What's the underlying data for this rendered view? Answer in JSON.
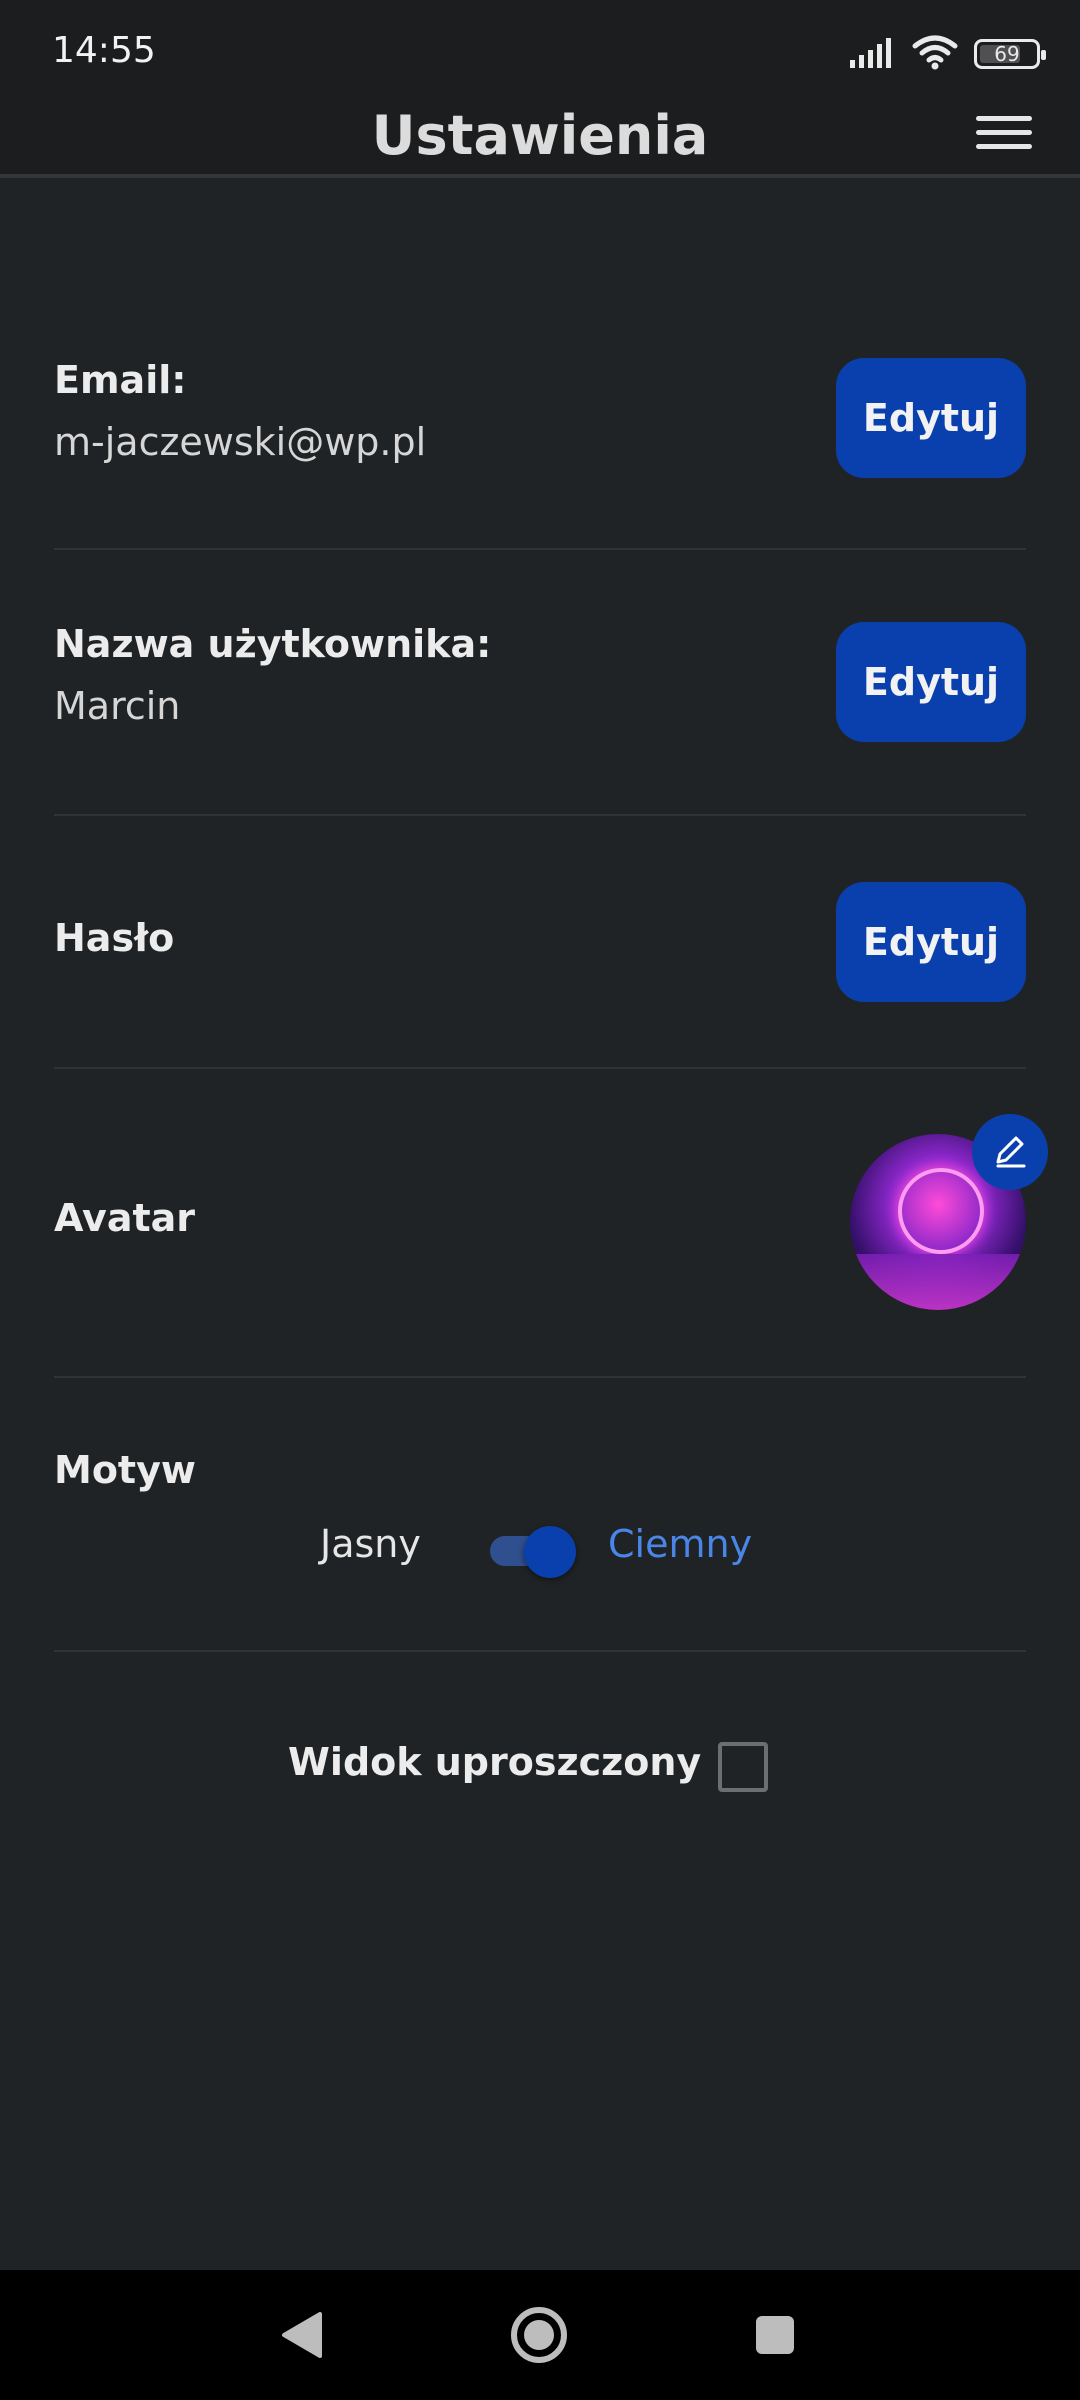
{
  "status_bar": {
    "time": "14:55",
    "battery": "69",
    "icons": [
      "signal-icon",
      "wifi-icon",
      "battery-icon"
    ]
  },
  "app_bar": {
    "title": "Ustawienia",
    "menu_icon": "hamburger-menu-icon"
  },
  "settings": {
    "email": {
      "label": "Email:",
      "value": "m-jaczewski@wp.pl",
      "button": "Edytuj"
    },
    "username": {
      "label": "Nazwa użytkownika:",
      "value": "Marcin",
      "button": "Edytuj"
    },
    "password": {
      "label": "Hasło",
      "button": "Edytuj"
    },
    "avatar": {
      "label": "Avatar",
      "edit_icon": "pencil-icon"
    },
    "theme": {
      "label": "Motyw",
      "light": "Jasny",
      "dark": "Ciemny",
      "dark_enabled": true
    },
    "simplified_view": {
      "label": "Widok uproszczony",
      "checked": false
    }
  },
  "nav_bar": {
    "icons": [
      "back-icon",
      "home-icon",
      "recents-icon"
    ]
  },
  "colors": {
    "background": "#202325",
    "accent": "#0a40ad",
    "active_text": "#4a86e8"
  }
}
